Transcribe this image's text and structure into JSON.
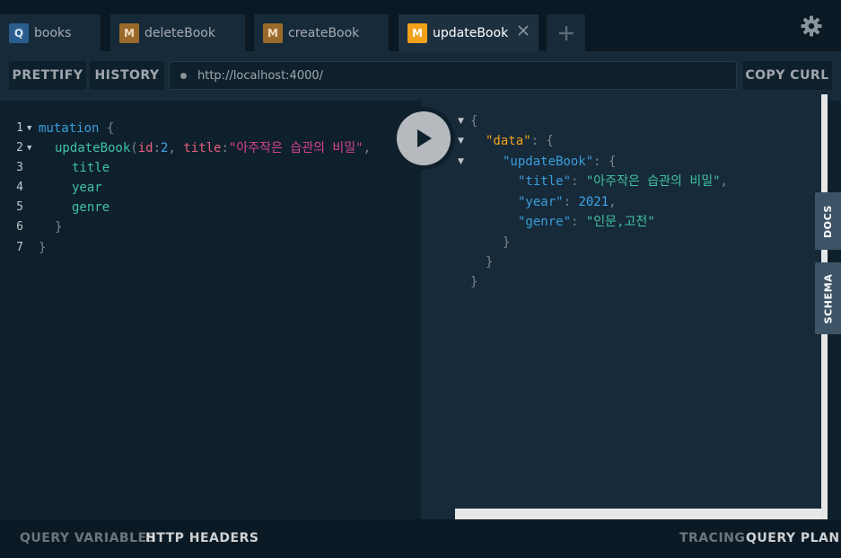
{
  "tabs": [
    {
      "badge": "Q",
      "label": "books"
    },
    {
      "badge": "M",
      "label": "deleteBook"
    },
    {
      "badge": "M",
      "label": "createBook"
    },
    {
      "badge": "M",
      "label": "updateBook"
    }
  ],
  "toolbar": {
    "prettify_label": "PRETTIFY",
    "history_label": "HISTORY",
    "endpoint_url": "http://localhost:4000/",
    "copy_curl_label": "COPY CURL"
  },
  "editor": {
    "line_numbers": [
      "1",
      "2",
      "3",
      "4",
      "5",
      "6",
      "7"
    ],
    "mutation_kw": "mutation",
    "open_brace": "{",
    "field_name": "updateBook",
    "paren_open": "(",
    "arg_id": "id",
    "colon": ":",
    "id_value": "2",
    "comma": ",",
    "arg_title": "title",
    "title_value": "\"아주작은 습관의 비밀\"",
    "trailing_comma": ",",
    "sel_title": "title",
    "sel_year": "year",
    "sel_genre": "genre",
    "close_inner": "}",
    "close_outer": "}"
  },
  "result": {
    "open": "{",
    "data_key": "\"data\"",
    "colon": ": {",
    "update_key": "\"updateBook\"",
    "title_key": "\"title\"",
    "title_value": "\"아주작은 습관의 비밀\"",
    "year_key": "\"year\"",
    "year_value": "2021",
    "genre_key": "\"genre\"",
    "genre_value": "\"인문,고전\"",
    "close": "}"
  },
  "side_tabs": {
    "docs": "DOCS",
    "schema": "SCHEMA"
  },
  "bottom": {
    "query_variables": "QUERY VARIABLES",
    "http_headers": "HTTP HEADERS",
    "tracing": "TRACING",
    "query_plan": "QUERY PLAN"
  },
  "colors": {
    "accent_orange": "#f2a11b",
    "query_badge": "#2b5d8f",
    "background": "#0f202d"
  }
}
